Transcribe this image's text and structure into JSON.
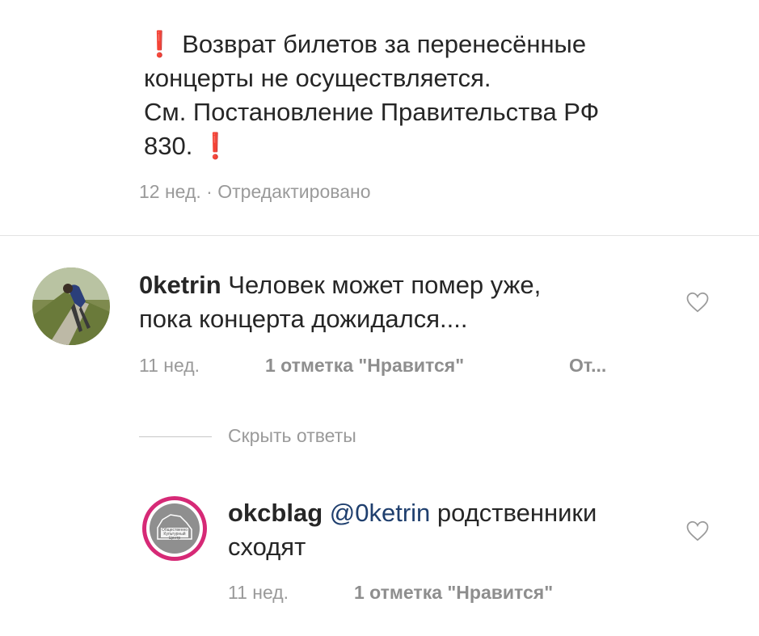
{
  "post": {
    "exclaim": "❗",
    "line1": "Возврат билетов за перенесённые",
    "line2": "концерты не осуществляется.",
    "line3": "См. Постановление Правительства РФ",
    "line4": "830.",
    "time": "12 нед.",
    "sep": "·",
    "edited": "Отредактировано"
  },
  "comment": {
    "username": "0ketrin",
    "line1": "Человек может помер уже,",
    "line2": "пока концерта дожидался....",
    "time": "11 нед.",
    "likes": "1 отметка \"Нравится\"",
    "reply": "От..."
  },
  "hide_replies": "Скрыть ответы",
  "reply": {
    "username": "okcblag",
    "mention": "@0ketrin",
    "text1": "родственники",
    "text2": "сходят",
    "time": "11 нед.",
    "likes": "1 отметка \"Нравится\"",
    "avatar_text": "Общественно Культурный Центр"
  },
  "icons": {
    "like_comment": "heart-icon",
    "like_reply": "heart-icon"
  },
  "colors": {
    "exclaim": "#e0211d",
    "mention": "#1f3f6e",
    "meta": "#9a9a9a",
    "story_ring": "#d62976"
  }
}
